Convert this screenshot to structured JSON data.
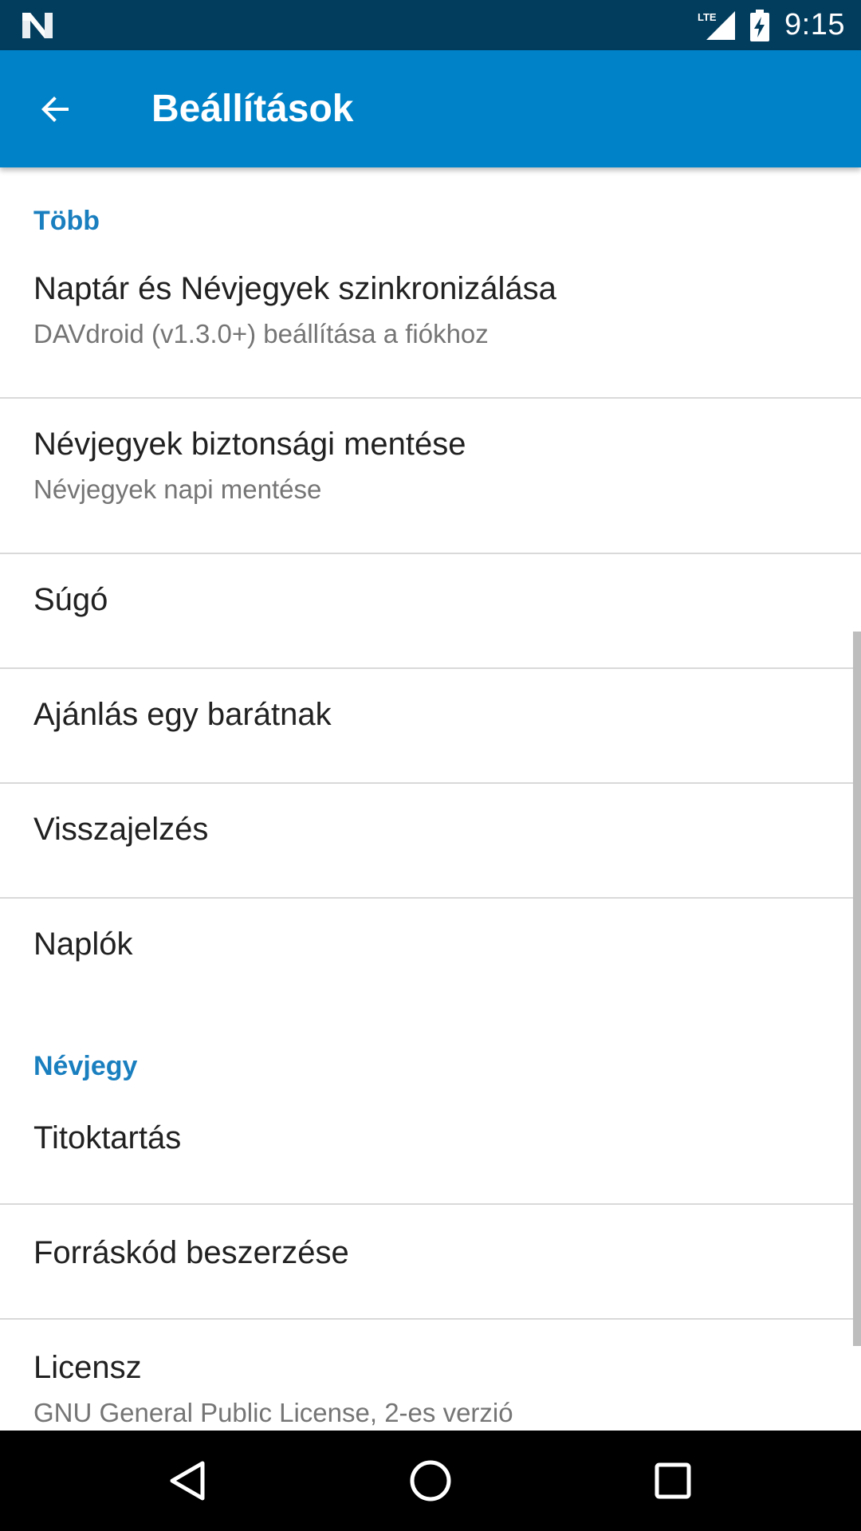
{
  "status_bar": {
    "time": "9:15",
    "network_label": "LTE",
    "icons": [
      "n-logo-icon",
      "lte-signal-icon",
      "battery-charging-icon"
    ]
  },
  "app_bar": {
    "title": "Beállítások",
    "back_icon": "arrow-back-icon"
  },
  "sections": [
    {
      "header": "Több",
      "items": [
        {
          "title": "Naptár és Névjegyek szinkronizálása",
          "summary": "DAVdroid (v1.3.0+) beállítása a fiókhoz"
        },
        {
          "title": "Névjegyek biztonsági mentése",
          "summary": "Névjegyek napi mentése"
        },
        {
          "title": "Súgó"
        },
        {
          "title": "Ajánlás egy barátnak"
        },
        {
          "title": "Visszajelzés"
        },
        {
          "title": "Naplók"
        }
      ]
    },
    {
      "header": "Névjegy",
      "items": [
        {
          "title": "Titoktartás"
        },
        {
          "title": "Forráskód beszerzése"
        },
        {
          "title": "Licensz",
          "summary": "GNU General Public License, 2-es verzió"
        }
      ]
    }
  ],
  "nav_bar": {
    "icons": [
      "back-triangle-icon",
      "home-circle-icon",
      "recents-square-icon"
    ]
  },
  "colors": {
    "status_bar": "#033d5e",
    "app_bar": "#0082c8",
    "accent": "#1a7fbf",
    "text_primary": "#212121",
    "text_secondary": "#757575",
    "divider": "#d9d9d9"
  }
}
